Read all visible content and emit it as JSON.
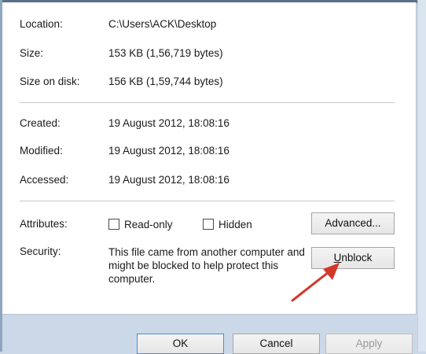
{
  "general": {
    "location_label": "Location:",
    "location_value": "C:\\Users\\ACK\\Desktop",
    "size_label": "Size:",
    "size_value": "153 KB (1,56,719 bytes)",
    "size_on_disk_label": "Size on disk:",
    "size_on_disk_value": "156 KB (1,59,744 bytes)",
    "created_label": "Created:",
    "created_value": "19 August 2012, 18:08:16",
    "modified_label": "Modified:",
    "modified_value": "19 August 2012, 18:08:16",
    "accessed_label": "Accessed:",
    "accessed_value": "19 August 2012, 18:08:16"
  },
  "attributes": {
    "label": "Attributes:",
    "readonly_label": "Read-only",
    "readonly_checked": false,
    "hidden_label": "Hidden",
    "hidden_checked": false,
    "advanced_button": "Advanced..."
  },
  "security": {
    "label": "Security:",
    "message": "This file came from another computer and might be blocked to help protect this computer.",
    "unblock_prefix": "",
    "unblock_mnemonic": "U",
    "unblock_rest": "nblock"
  },
  "footer": {
    "ok_label": "OK",
    "cancel_label": "Cancel",
    "apply_label": "Apply"
  },
  "colors": {
    "annotation_arrow": "#d2382a",
    "focus_border": "#4d8cd6"
  },
  "icons": {
    "annotation": "red-arrow-icon"
  }
}
